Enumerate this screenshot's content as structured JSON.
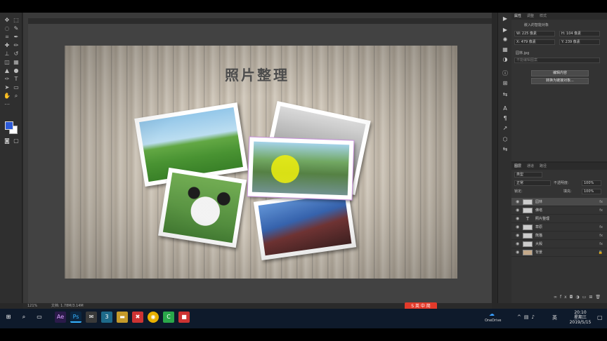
{
  "document": {
    "title": "照片整理",
    "tab_label": "",
    "zoom": "121%",
    "doc_info": "文档: 1.78M/3.14M"
  },
  "properties": {
    "tabs": [
      "属性",
      "调整",
      "样式"
    ],
    "object_type": "嵌入的智能对象",
    "W": "W: 225 像素",
    "H": "H: 104 像素",
    "X": "X: 479 像素",
    "Y": "Y: 239 像素",
    "file_name": "园林.jpg",
    "placeholder": "不能编辑图案",
    "edit_button": "编辑内容",
    "convert_button": "转换为链接对象..."
  },
  "layers": {
    "tabs": [
      "图层",
      "通道",
      "路径"
    ],
    "filter_kind": "类型",
    "blend_mode": "正常",
    "opacity_label": "不透明度:",
    "opacity_value": "100%",
    "lock_label": "锁定:",
    "fill_label": "填充:",
    "fill_value": "100%",
    "items": [
      {
        "name": "园林",
        "fx": "fx",
        "selected": true
      },
      {
        "name": "佛塔",
        "fx": "fx",
        "selected": false
      },
      {
        "name": "照片整理",
        "fx": "",
        "selected": false
      },
      {
        "name": "草原",
        "fx": "fx",
        "selected": false
      },
      {
        "name": "熊猫",
        "fx": "fx",
        "selected": false
      },
      {
        "name": "大殿",
        "fx": "fx",
        "selected": false
      },
      {
        "name": "背景",
        "fx": "",
        "selected": false
      }
    ]
  },
  "taskbar": {
    "time": "20:10",
    "weekday": "星期三",
    "date": "2019/5/15",
    "onedrive": "OneDrive",
    "ime": "英",
    "ime_badge": "S 英 中 简"
  },
  "colors": {
    "foreground": "#2d5bd8",
    "background": "#ffffff",
    "accent": "#c58bd8"
  }
}
